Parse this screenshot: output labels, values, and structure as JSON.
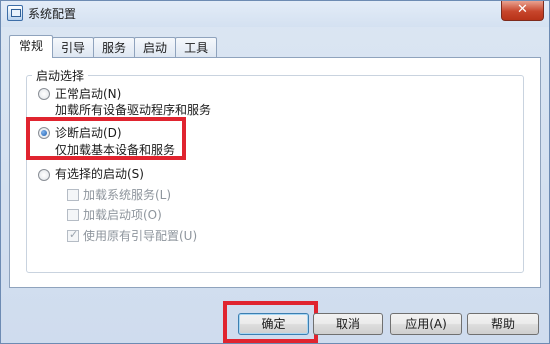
{
  "window": {
    "title": "系统配置",
    "close_label": "✕"
  },
  "tabs": [
    {
      "label": "常规",
      "active": true
    },
    {
      "label": "引导",
      "active": false
    },
    {
      "label": "服务",
      "active": false
    },
    {
      "label": "启动",
      "active": false
    },
    {
      "label": "工具",
      "active": false
    }
  ],
  "startup": {
    "group_title": "启动选择",
    "normal": {
      "label": "正常启动(N)",
      "desc": "加载所有设备驱动程序和服务",
      "checked": false
    },
    "diagnostic": {
      "label": "诊断启动(D)",
      "desc": "仅加载基本设备和服务",
      "checked": true
    },
    "selective": {
      "label": "有选择的启动(S)",
      "checked": false,
      "options": [
        {
          "label": "加载系统服务(L)",
          "checked": false
        },
        {
          "label": "加载启动项(O)",
          "checked": false
        },
        {
          "label": "使用原有引导配置(U)",
          "checked": true
        }
      ]
    }
  },
  "buttons": {
    "ok": "确定",
    "cancel": "取消",
    "apply": "应用(A)",
    "help": "帮助"
  },
  "colors": {
    "highlight": "#e0242f",
    "accent": "#3c7fb1"
  }
}
